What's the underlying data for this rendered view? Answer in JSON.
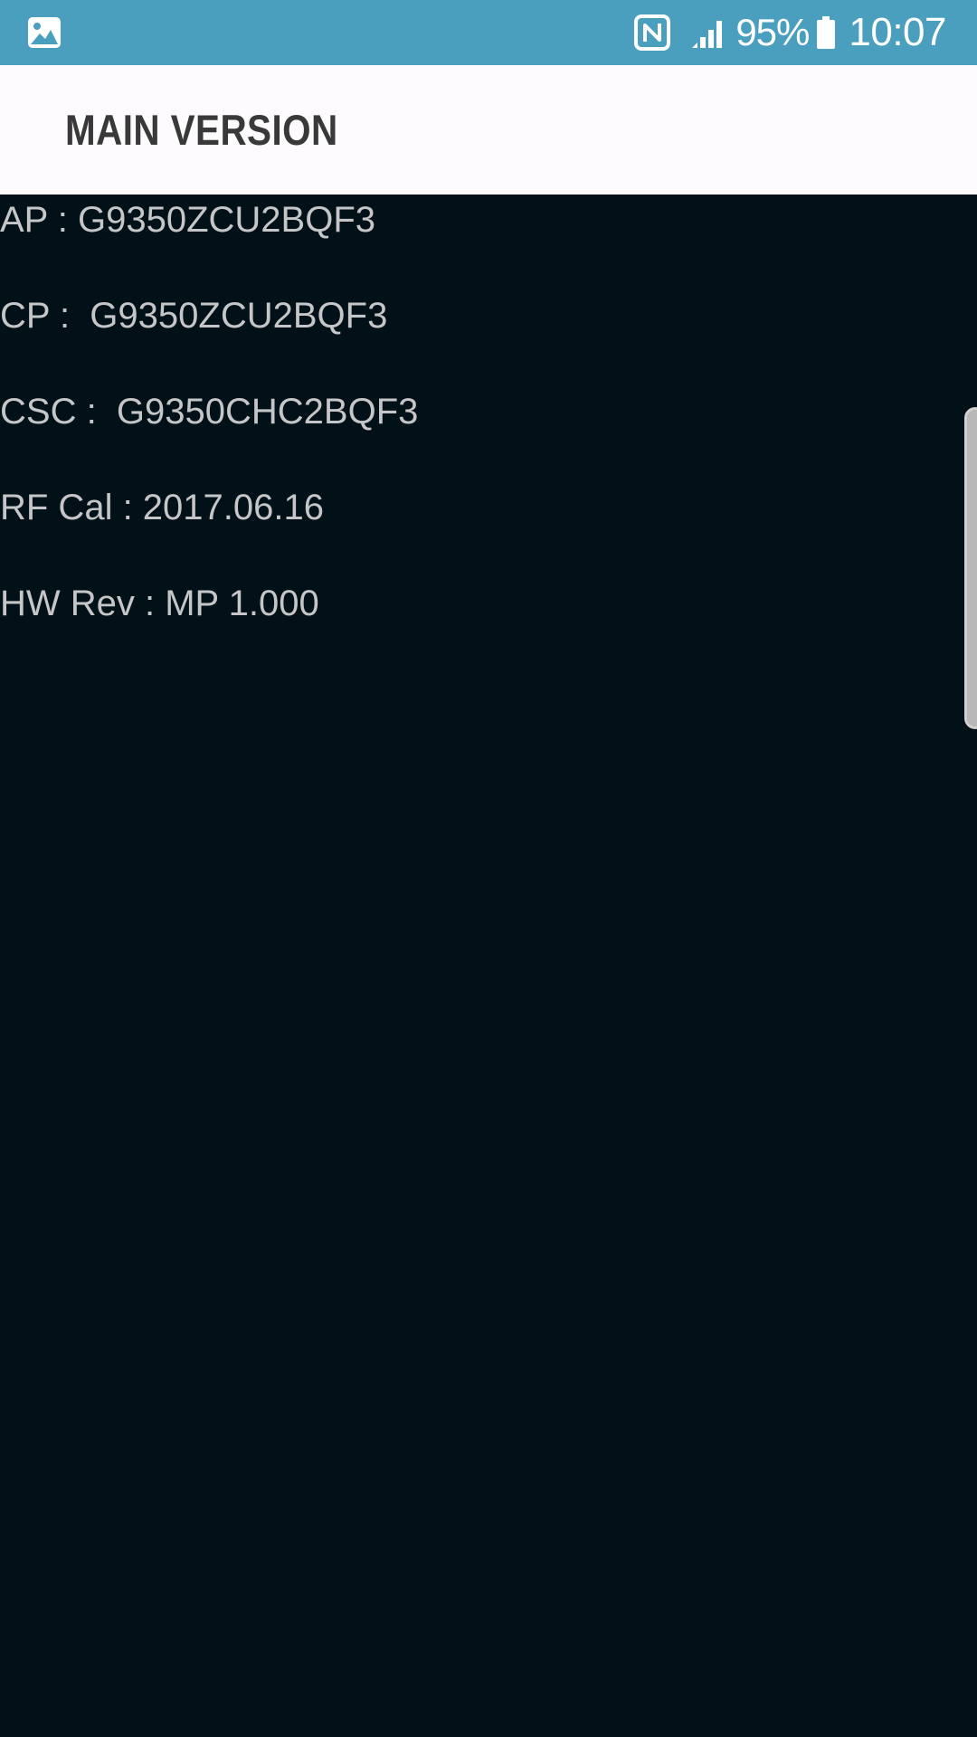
{
  "status_bar": {
    "left_icon": "gallery-image-icon",
    "nfc_icon": "nfc-icon",
    "signal_icon": "signal-strength-icon",
    "battery_percent": "95%",
    "battery_icon": "battery-icon",
    "time": "10:07",
    "background_color": "#4a9fbe"
  },
  "header": {
    "title": "MAIN VERSION"
  },
  "info": {
    "rows": [
      {
        "text": "AP : G9350ZCU2BQF3"
      },
      {
        "text": "CP :  G9350ZCU2BQF3"
      },
      {
        "text": "CSC :  G9350CHC2BQF3"
      },
      {
        "text": "RF Cal : 2017.06.16"
      },
      {
        "text": "HW Rev : MP 1.000"
      }
    ]
  },
  "colors": {
    "background": "#021118",
    "header_bg": "#fdfbfe",
    "text": "#c4c6c7"
  }
}
